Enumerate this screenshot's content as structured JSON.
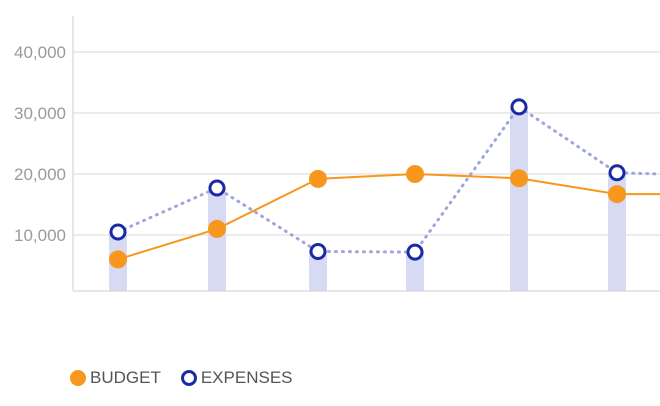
{
  "chart_data": {
    "type": "line",
    "categories": [
      "",
      "",
      "",
      "",
      "",
      ""
    ],
    "ylim": [
      0,
      45000
    ],
    "y_ticks": [
      10000,
      20000,
      30000,
      40000
    ],
    "y_tick_labels": [
      "10,000",
      "20,000",
      "30,000",
      "40,000"
    ],
    "grid": true,
    "legend_position": "bottom-left",
    "series": [
      {
        "name": "BUDGET",
        "style": "solid line with filled circles",
        "color": "#f7971e",
        "values": [
          6000,
          11000,
          19200,
          20000,
          19300,
          16700
        ],
        "trailing_value": 16700
      },
      {
        "name": "EXPENSES",
        "style": "dotted line with hollow circles and bars",
        "color": "#1a2aa6",
        "line_color": "#9fa6dc",
        "bar_color": "#d7daf3",
        "values": [
          10500,
          17700,
          7300,
          7200,
          31000,
          20200
        ],
        "trailing_value": 20000
      }
    ]
  }
}
